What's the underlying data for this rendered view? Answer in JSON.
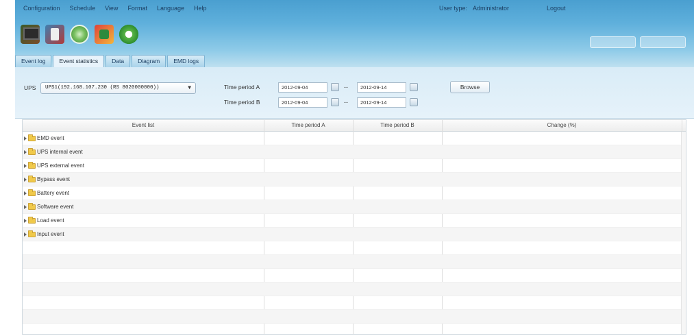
{
  "menu": [
    "Configuration",
    "Schedule",
    "View",
    "Format",
    "Language",
    "Help"
  ],
  "user": {
    "label": "User type:",
    "value": "Administrator",
    "logout": "Logout"
  },
  "toolbar_icons": [
    "ups-monitor-icon",
    "ups-config-icon",
    "status-icon",
    "battery-icon",
    "refresh-icon"
  ],
  "tabs": [
    "Event log",
    "Event statistics",
    "Data",
    "Diagram",
    "EMD logs"
  ],
  "active_tab": "Event statistics",
  "filter": {
    "ups_label": "UPS",
    "ups_value": "UPS1(192.168.107.230 (RS 8020000000))",
    "period_a_label": "Time period A",
    "period_b_label": "Time period B",
    "period_a_from": "2012-09-04",
    "period_a_to": "2012-09-14",
    "period_b_from": "2012-09-04",
    "period_b_to": "2012-09-14",
    "separator": "--",
    "browse": "Browse"
  },
  "grid": {
    "columns": [
      "Event list",
      "Time period A",
      "Time period B",
      "Change (%)"
    ],
    "rows": [
      "EMD event",
      "UPS internal event",
      "UPS external event",
      "Bypass event",
      "Battery event",
      "Software event",
      "Load event",
      "Input event"
    ]
  }
}
